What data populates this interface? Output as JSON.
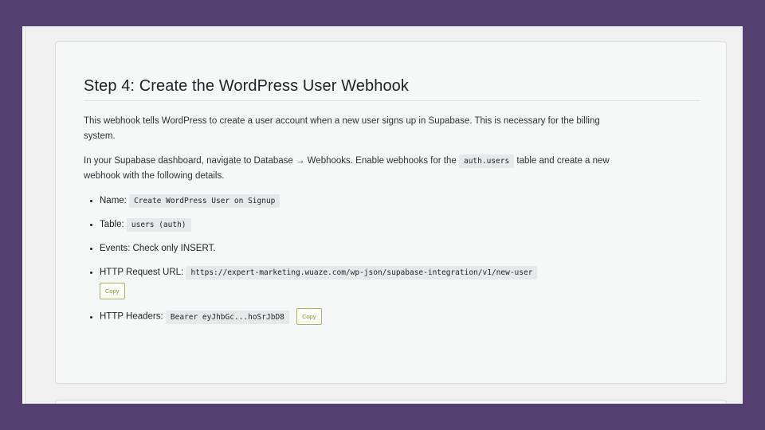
{
  "step": {
    "title": "Step 4: Create the WordPress User Webhook",
    "intro": "This webhook tells WordPress to create a user account when a new user signs up in Supabase. This is necessary for the billing system.",
    "instructions": {
      "prefix": "In your Supabase dashboard, navigate to Database → Webhooks. Enable webhooks for the",
      "code": "auth.users",
      "suffix": "table and create a new webhook with the following details."
    },
    "details": [
      {
        "label": "Name:",
        "value": "Create WordPress User on Signup"
      },
      {
        "label": "Table:",
        "value": "users (auth)"
      },
      {
        "label": "Events: Check only INSERT."
      },
      {
        "label": "HTTP Request URL:",
        "value": "https://expert-marketing.wuaze.com/wp-json/supabase-integration/v1/new-user",
        "copy_label": "Copy"
      },
      {
        "label": "HTTP Headers:",
        "value": "Bearer eyJhbGc...hoSrJbD8",
        "copy_label": "Copy"
      }
    ]
  },
  "colors": {
    "frame": "#533f70",
    "card": "#f6f7f7",
    "copy_accent": "#9fba5a"
  }
}
